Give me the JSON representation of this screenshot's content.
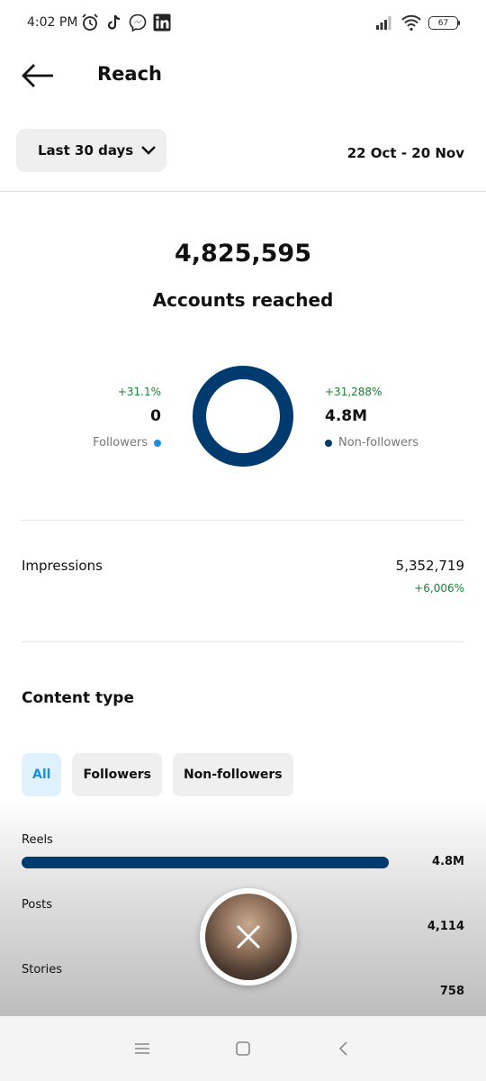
{
  "status_bar": {
    "time": "4:02 PM",
    "battery": "67",
    "left_icons": [
      "alarm-icon",
      "tiktok-icon",
      "messenger-icon",
      "linkedin-icon"
    ],
    "right_icons": [
      "signal-icon",
      "wifi-icon",
      "battery-icon"
    ]
  },
  "header": {
    "title": "Reach",
    "back_icon": "back-arrow-icon"
  },
  "range": {
    "selector_label": "Last 30 days",
    "date_range": "22 Oct - 20 Nov"
  },
  "summary": {
    "accounts_reached_value": "4,825,595",
    "accounts_reached_label": "Accounts reached"
  },
  "audience": {
    "followers": {
      "change": "+31.1%",
      "value": "0",
      "label": "Followers",
      "color": "#1e8fe0"
    },
    "non_followers": {
      "change": "+31,288%",
      "value": "4.8M",
      "label": "Non-followers",
      "color": "#003b6f"
    },
    "donut_non_follower_share": 1.0
  },
  "impressions": {
    "label": "Impressions",
    "value": "5,352,719",
    "change": "+6,006%"
  },
  "content_type": {
    "title": "Content type",
    "tabs": [
      {
        "label": "All",
        "active": true
      },
      {
        "label": "Followers",
        "active": false
      },
      {
        "label": "Non-followers",
        "active": false
      }
    ],
    "rows": [
      {
        "label": "Reels",
        "value": "4.8M",
        "share": 0.999
      },
      {
        "label": "Posts",
        "value": "4,114",
        "share": 0.001
      },
      {
        "label": "Stories",
        "value": "758",
        "share": 0.0002
      }
    ]
  },
  "floating_button": {
    "icon": "close-icon"
  },
  "nav_bar": {
    "icons": [
      "menu-icon",
      "home-square-icon",
      "back-chevron-icon"
    ]
  },
  "colors": {
    "accent_blue": "#1e8fe0",
    "navy": "#003b6f",
    "positive_green": "#1a7f37"
  }
}
